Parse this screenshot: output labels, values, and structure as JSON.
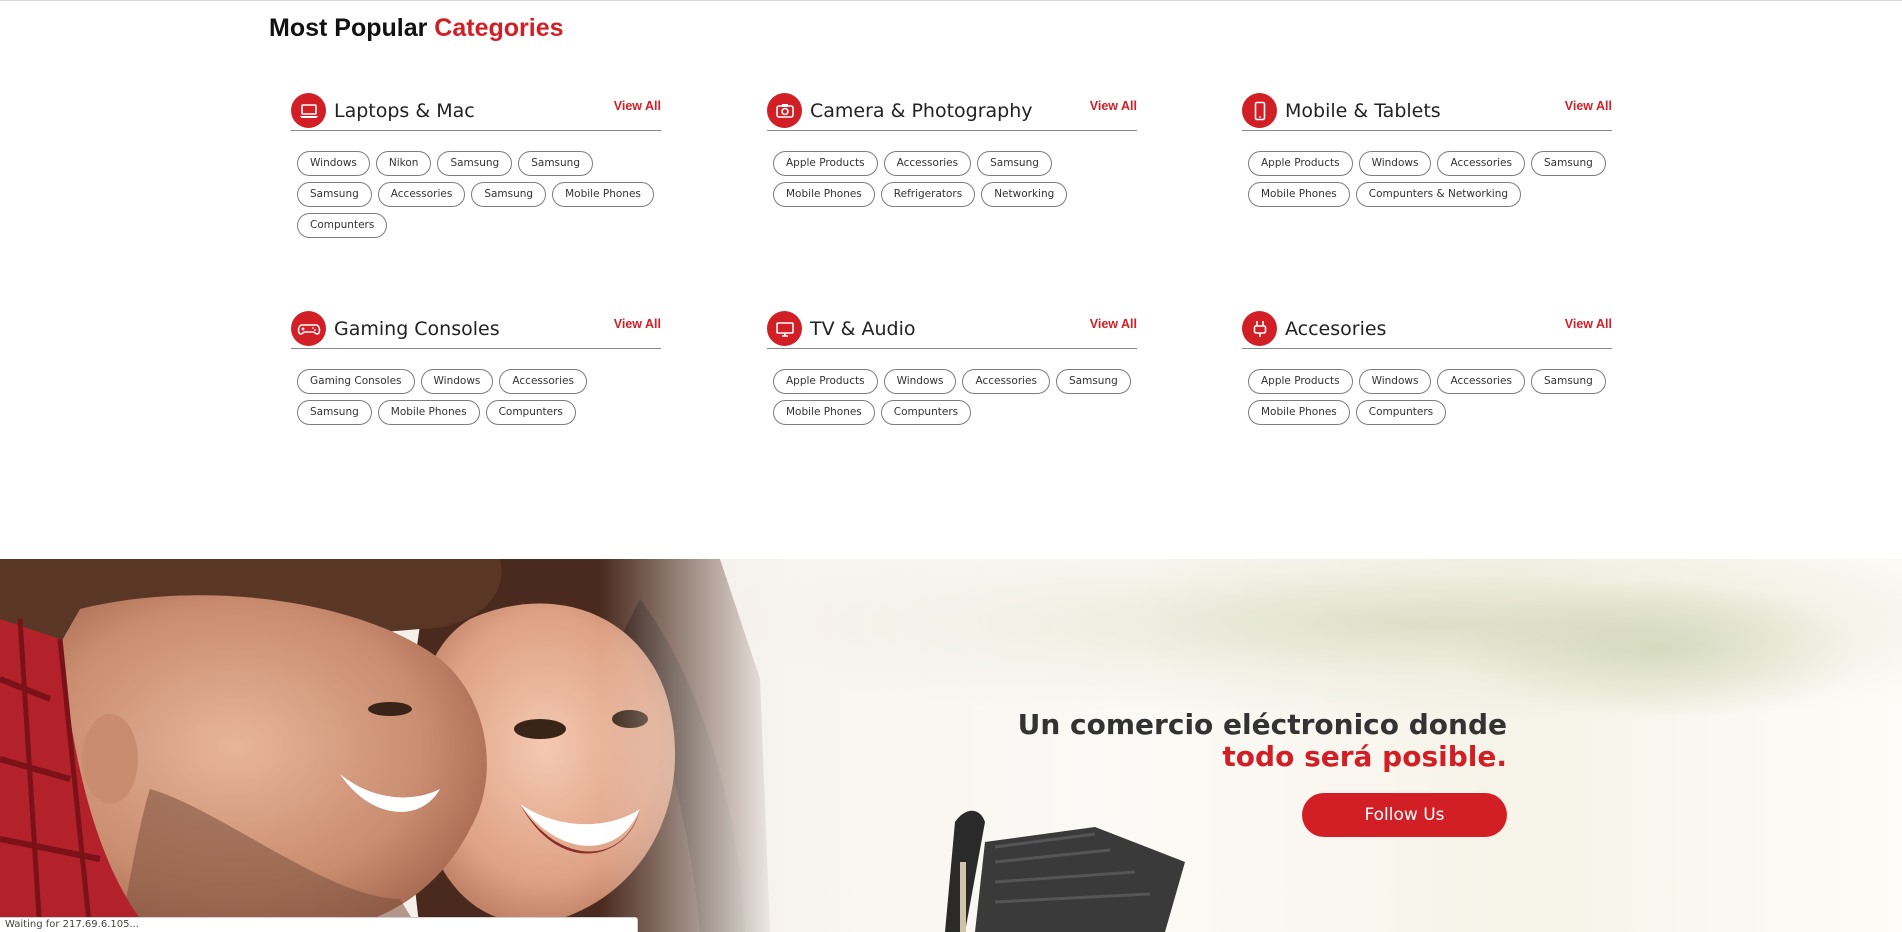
{
  "section": {
    "title_main": "Most Popular",
    "title_accent": "Categories"
  },
  "categories": [
    {
      "title": "Laptops & Mac",
      "icon": "laptop-icon",
      "view_all": "View All",
      "tags": [
        "Windows",
        "Nikon",
        "Samsung",
        "Samsung",
        "Samsung",
        "Accessories",
        "Samsung",
        "Mobile Phones",
        "Compunters"
      ]
    },
    {
      "title": "Camera & Photography",
      "icon": "camera-icon",
      "view_all": "View All",
      "tags": [
        "Apple Products",
        "Accessories",
        "Samsung",
        "Mobile Phones",
        "Refrigerators",
        "Networking"
      ]
    },
    {
      "title": "Mobile & Tablets",
      "icon": "mobile-phone-icon",
      "view_all": "View All",
      "tags": [
        "Apple Products",
        "Windows",
        "Accessories",
        "Samsung",
        "Mobile Phones",
        "Compunters & Networking"
      ]
    },
    {
      "title": "Gaming Consoles",
      "icon": "gamepad-icon",
      "view_all": "View All",
      "tags": [
        "Gaming Consoles",
        "Windows",
        "Accessories",
        "Samsung",
        "Mobile Phones",
        "Compunters"
      ]
    },
    {
      "title": "TV & Audio",
      "icon": "tv-icon",
      "view_all": "View All",
      "tags": [
        "Apple Products",
        "Windows",
        "Accessories",
        "Samsung",
        "Mobile Phones",
        "Compunters"
      ]
    },
    {
      "title": "Accesories",
      "icon": "plug-icon",
      "view_all": "View All",
      "tags": [
        "Apple Products",
        "Windows",
        "Accessories",
        "Samsung",
        "Mobile Phones",
        "Compunters"
      ]
    }
  ],
  "hero": {
    "line1": "Un comercio eléctronico donde",
    "line2": "todo será posible.",
    "button_label": "Follow Us"
  },
  "status_bar": {
    "text": "Waiting for 217.69.6.105..."
  },
  "colors": {
    "accent": "#d21f26",
    "heading": "#111111",
    "tag_border": "#7d7d7d"
  }
}
